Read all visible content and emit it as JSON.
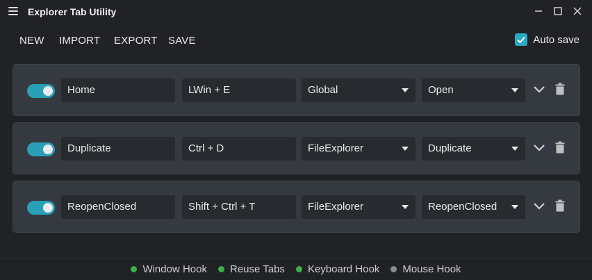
{
  "app": {
    "title": "Explorer Tab Utility"
  },
  "toolbar": {
    "new_label": "NEW",
    "import_label": "IMPORT",
    "export_label": "EXPORT",
    "save_label": "SAVE",
    "autosave_label": "Auto save",
    "autosave_checked": true
  },
  "hotkeys": [
    {
      "enabled": true,
      "name": "Home",
      "keys": "LWin + E",
      "scope": "Global",
      "action": "Open"
    },
    {
      "enabled": true,
      "name": "Duplicate",
      "keys": "Ctrl + D",
      "scope": "FileExplorer",
      "action": "Duplicate"
    },
    {
      "enabled": true,
      "name": "ReopenClosed",
      "keys": "Shift + Ctrl + T",
      "scope": "FileExplorer",
      "action": "ReopenClosed"
    }
  ],
  "status": [
    {
      "label": "Window Hook",
      "active": true
    },
    {
      "label": "Reuse Tabs",
      "active": true
    },
    {
      "label": "Keyboard Hook",
      "active": true
    },
    {
      "label": "Mouse Hook",
      "active": false
    }
  ],
  "colors": {
    "accent": "#2a9fb8",
    "status_on": "#3fae49",
    "status_off": "#8a8c8f",
    "row_bg": "#353a41",
    "field_bg": "#272a2f"
  },
  "icons": {
    "menu": "hamburger-menu-icon",
    "minimize": "minimize-icon",
    "maximize": "maximize-icon",
    "close": "close-icon",
    "expand": "chevron-down-icon",
    "delete": "trash-icon",
    "check": "checkmark-icon"
  }
}
